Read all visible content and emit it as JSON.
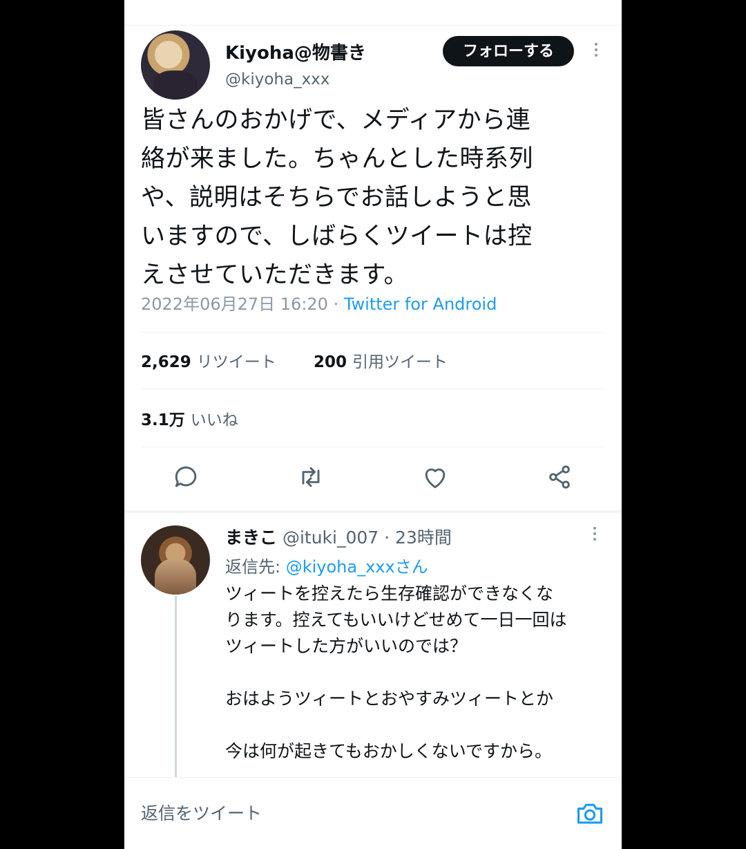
{
  "tweet": {
    "author_name": "Kiyoha@物書き",
    "author_handle": "@kiyoha_xxx",
    "follow_label": "フォローする",
    "text_lines": [
      "皆さんのおかげで、メディアから連",
      "絡が来ました。ちゃんとした時系列",
      "や、説明はそちらでお話しようと思",
      "いますので、しばらくツイートは控",
      "えさせていただきます。"
    ],
    "timestamp": "2022年06月27日 16:20",
    "separator": " · ",
    "source": "Twitter for Android",
    "retweets_count": "2,629",
    "retweets_label": "リツイート",
    "quotes_count": "200",
    "quotes_label": "引用ツイート",
    "likes_count": "3.1万",
    "likes_label": "いいね"
  },
  "actions": {
    "reply_icon": "comment-icon",
    "retweet_icon": "retweet-icon",
    "like_icon": "heart-icon",
    "share_icon": "share-icon"
  },
  "reply": {
    "author_name": "まきこ",
    "author_handle": "@ituki_007",
    "separator": " · ",
    "time": "23時間",
    "replying_prefix": "返信先: ",
    "replying_to": "@kiyoha_xxxさん",
    "text_lines": [
      "ツィートを控えたら生存確認ができなくな",
      "ります。控えてもいいけどせめて一日一回は",
      "ツィートした方がいいのでは？",
      "",
      "おはようツィートとおやすみツィートとか",
      "",
      "今は何が起きてもおかしくないですから。"
    ]
  },
  "compose": {
    "placeholder": "返信をツイート",
    "camera_icon": "camera-icon"
  },
  "colors": {
    "accent": "#1d9bf0",
    "text": "#0f1419",
    "secondary": "#536471",
    "divider": "#eff3f4"
  }
}
